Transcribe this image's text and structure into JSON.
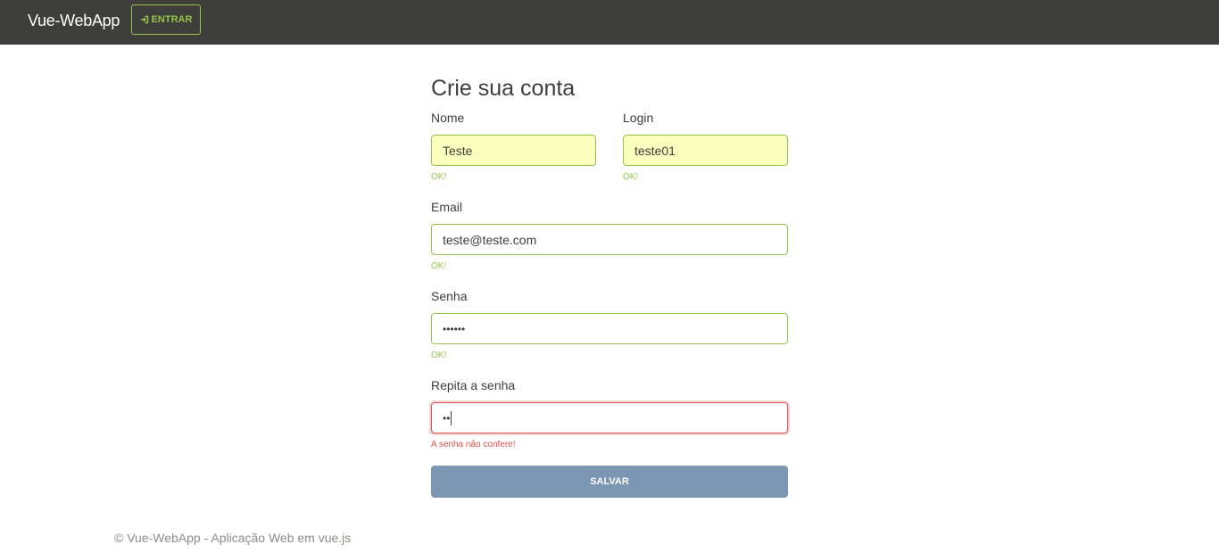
{
  "navbar": {
    "brand": "Vue-WebApp",
    "login_button": {
      "icon": "sign-in-icon",
      "label": "ENTRAR"
    }
  },
  "form": {
    "title": "Crie sua conta",
    "fields": {
      "nome": {
        "label": "Nome",
        "value": "Teste",
        "feedback": "OK!"
      },
      "login": {
        "label": "Login",
        "value": "teste01",
        "feedback": "OK!"
      },
      "email": {
        "label": "Email",
        "value": "teste@teste.com",
        "feedback": "OK!"
      },
      "senha": {
        "label": "Senha",
        "value": "••••••",
        "feedback": "OK!"
      },
      "repita": {
        "label": "Repita a senha",
        "value": "••",
        "feedback": "A senha não confere!"
      }
    },
    "submit_label": "SALVAR"
  },
  "footer": {
    "text": "© Vue-WebApp - Aplicação Web em vue.js"
  },
  "colors": {
    "navbar": "#3e3f3a",
    "success": "#93c54b",
    "danger": "#d9534f",
    "autofill": "#faffbd",
    "submit": "#7a96b3"
  }
}
